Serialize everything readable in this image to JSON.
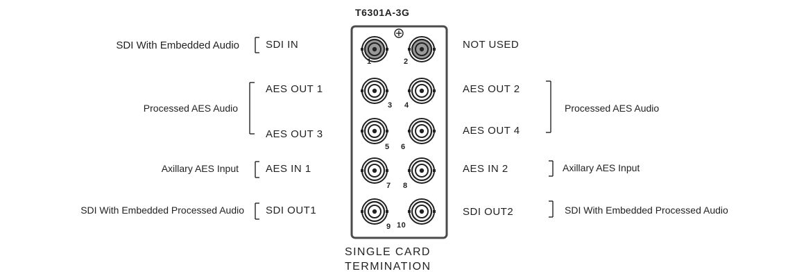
{
  "title": "T6301A-3G",
  "left_descriptions": {
    "sdi_in": "SDI With Embedded Audio",
    "processed_aes": "Processed AES Audio",
    "aux_aes": "Axillary AES Input",
    "sdi_out": "SDI With Embedded Processed Audio"
  },
  "left_ports": {
    "sdi_in": "SDI IN",
    "aes_out_1": "AES OUT 1",
    "aes_out_3": "AES OUT 3",
    "aes_in_1": "AES IN 1",
    "sdi_out_1": "SDI OUT1"
  },
  "right_ports": {
    "not_used": "NOT USED",
    "aes_out_2": "AES OUT 2",
    "aes_out_4": "AES OUT 4",
    "aes_in_2": "AES IN 2",
    "sdi_out_2": "SDI OUT2"
  },
  "right_descriptions": {
    "processed_aes": "Processed AES Audio",
    "aux_aes": "Axillary AES Input",
    "sdi_out": "SDI With Embedded Processed Audio"
  },
  "connector_numbers": [
    "1",
    "2",
    "3",
    "4",
    "5",
    "6",
    "7",
    "8",
    "9",
    "10"
  ],
  "footer": {
    "line1": "SINGLE CARD",
    "line2": "TERMINATION"
  },
  "colors": {
    "ink": "#222222",
    "panel_border": "#4a4a4a",
    "connector_fill_inactive": "#9a9a9a"
  }
}
